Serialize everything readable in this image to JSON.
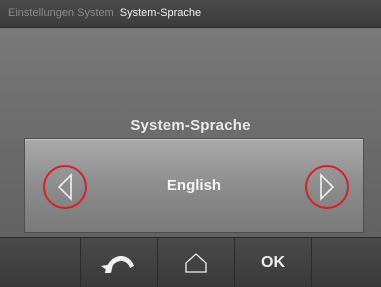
{
  "header": {
    "breadcrumb_parent": "Einstellungen System",
    "breadcrumb_current": "System-Sprache"
  },
  "main": {
    "setting_label": "System-Sprache",
    "selected_value": "English",
    "prev_icon": "chevron-left-icon",
    "next_icon": "chevron-right-icon",
    "highlight_color": "#d6202a"
  },
  "bottom_bar": {
    "back_icon": "back-arrow-icon",
    "home_icon": "home-icon",
    "ok_label": "OK"
  }
}
